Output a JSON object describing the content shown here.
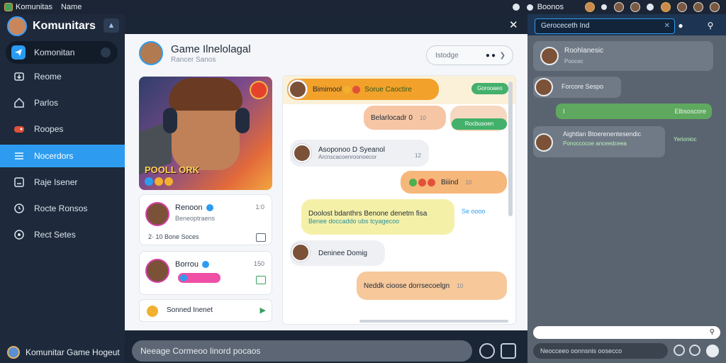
{
  "topbar": {
    "app_name": "Komunitas",
    "section": "Name",
    "right_label": "Boonos"
  },
  "sidebar": {
    "title": "Komunitars",
    "items": [
      {
        "label": "Komonitan"
      },
      {
        "label": "Reome"
      },
      {
        "label": "Parlos"
      },
      {
        "label": "Roopes"
      },
      {
        "label": "Nocerdors"
      },
      {
        "label": "Raje Isener"
      },
      {
        "label": "Rocte Ronsos"
      },
      {
        "label": "Rect Setes"
      }
    ],
    "footer": "Komunitar Game Hogeut"
  },
  "main": {
    "title": "Game Ilnelolagal",
    "subtitle": "Rancer Sanos",
    "search_value": "Istodge",
    "game_card": {
      "title": "POOLL ORK"
    },
    "user_cards": [
      {
        "name": "Renoon",
        "sub": "Beneoptraens",
        "num": "1:0",
        "stats": "2· 10 Bone Soces"
      },
      {
        "name": "Borrou",
        "num": "150"
      }
    ],
    "list_item": "Sonned Inenet",
    "composer_placeholder": "Neeage Cormeoo linord pocaos"
  },
  "chat": {
    "header_text": "Bimimool",
    "header_rest": "Sorue Caoctire",
    "header_tag": "Gorooaeo",
    "messages": [
      {
        "text": "Belarlocadr 0",
        "time": "10"
      },
      {
        "tag": "Rocbusoen"
      },
      {
        "text": "Asoponoo D Syeanol",
        "sub": "Arcnscacoenroonoecor",
        "time": "12"
      },
      {
        "text": "Biiind",
        "time": "10"
      },
      {
        "text": "Doolost bdanthrs Benone denetm fisa",
        "sub": "Benee doccaddo ubs tcyagecoo",
        "side": "Se oooo"
      },
      {
        "text": "Deninee Domig"
      },
      {
        "text": "Neddk cioose dorrsecoelgn",
        "time": "10"
      }
    ]
  },
  "right_panel": {
    "search": "Geroceceth Ind",
    "cards": [
      {
        "title": "Roohlanesic",
        "sub": "Poocec"
      },
      {
        "title": "Forcore Sespo"
      },
      {
        "label": "I",
        "right": "Elbsoscore"
      },
      {
        "title": "Aightlan Btoerenentesendic",
        "sub": "Ponoccocoe anceedceea",
        "tag": "Yerionioc"
      }
    ],
    "input": "",
    "bar": "Neocceeo oonnsnis oosecco"
  }
}
